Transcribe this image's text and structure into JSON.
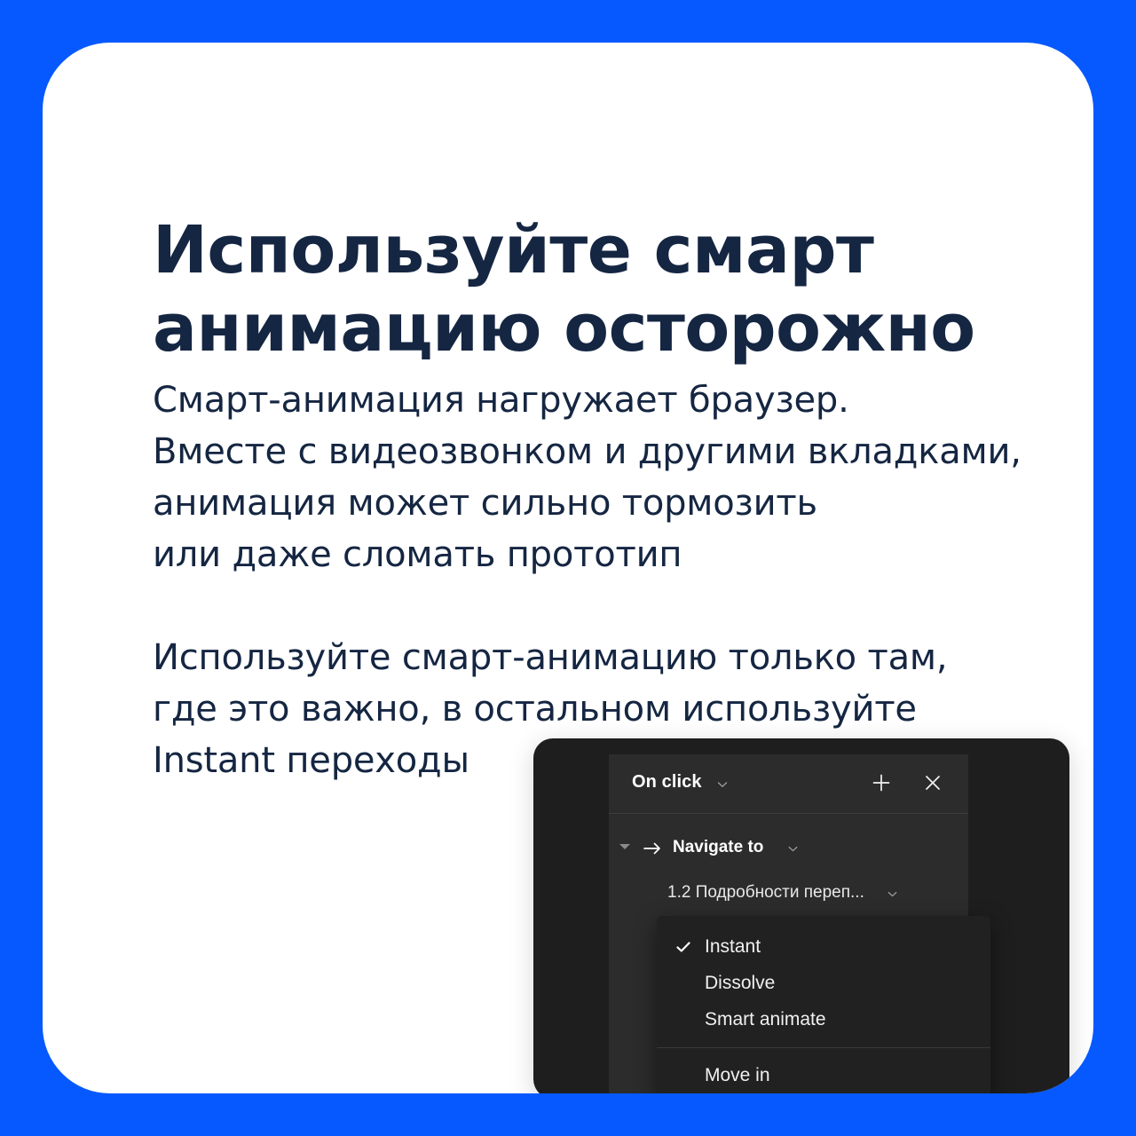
{
  "theme": {
    "background_blue": "#0659fe",
    "card_white": "#ffffff",
    "text_navy": "#152642",
    "panel_dark": "#1e1e1e",
    "popover_dark": "#2c2c2c",
    "menu_dark": "#212121"
  },
  "headline": {
    "lines": [
      "Используйте смарт",
      "анимацию осторожно"
    ]
  },
  "body": {
    "paragraph_1": [
      "Смарт-анимация нагружает браузер.",
      "Вместе с видеозвонком и другими вкладками,",
      "анимация может сильно тормозить",
      "или даже сломать прототип"
    ],
    "paragraph_2": [
      "Используйте смарт-анимацию только там,",
      "где это важно, в остальном используйте",
      "Instant переходы"
    ]
  },
  "figma_panel": {
    "popover": {
      "trigger": {
        "label": "On click",
        "chevron_icon": "chevron-down-icon"
      },
      "header_actions": {
        "add_icon": "plus-icon",
        "close_icon": "close-icon"
      },
      "action": {
        "disclosure_icon": "triangle-down-icon",
        "arrow_icon": "arrow-right-icon",
        "label": "Navigate to",
        "chevron_icon": "chevron-down-icon"
      },
      "destination": {
        "label": "1.2 Подробности переп...",
        "chevron_icon": "chevron-down-icon"
      }
    },
    "animation_menu": {
      "items": [
        {
          "label": "Instant",
          "checked": true
        },
        {
          "label": "Dissolve",
          "checked": false
        },
        {
          "label": "Smart animate",
          "checked": false
        }
      ],
      "group_2": [
        {
          "label": "Move in",
          "checked": false
        }
      ],
      "check_icon": "check-icon"
    }
  }
}
